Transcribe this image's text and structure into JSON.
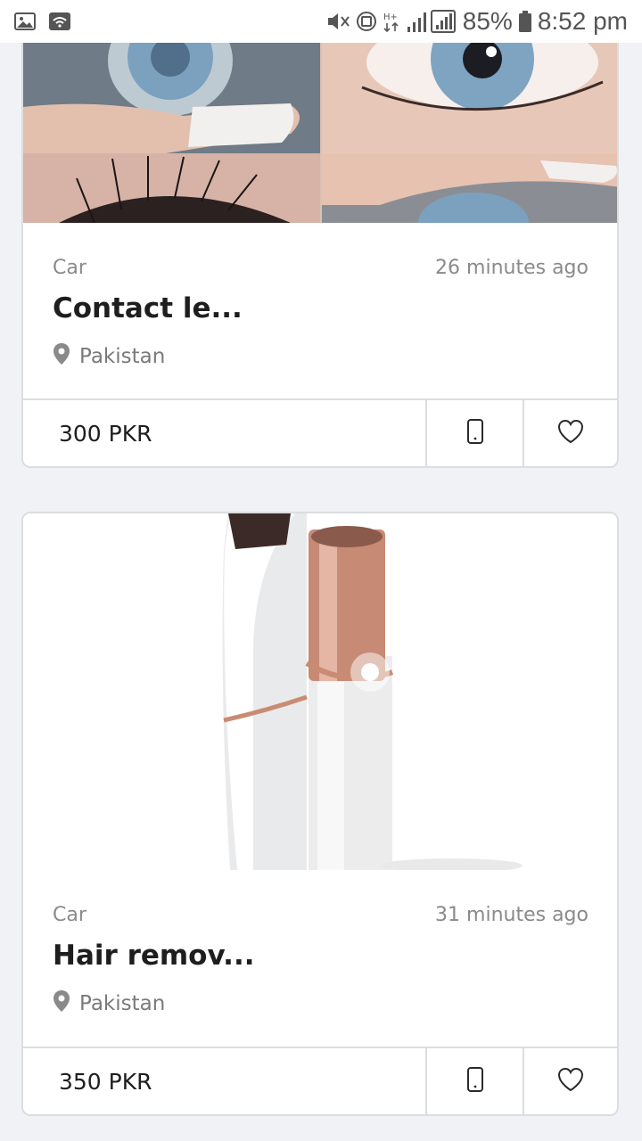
{
  "status_bar": {
    "battery": "85%",
    "time": "8:52 pm",
    "icons": [
      "gallery-icon",
      "wifi-icon",
      "mute-icon",
      "globe-icon",
      "network-type-icon",
      "signal-icon",
      "battery-icon"
    ]
  },
  "listings": [
    {
      "category": "Car",
      "time": "26 minutes ago",
      "title": "Contact le...",
      "location": "Pakistan",
      "price": "300 PKR",
      "image": "contact-lens-photo"
    },
    {
      "category": "Car",
      "time": "31 minutes ago",
      "title": "Hair remov...",
      "location": "Pakistan",
      "price": "350 PKR",
      "image": "hair-remover-photo"
    }
  ],
  "icons": {
    "phone": "phone-icon",
    "favorite": "heart-icon",
    "location": "location-pin-icon"
  }
}
